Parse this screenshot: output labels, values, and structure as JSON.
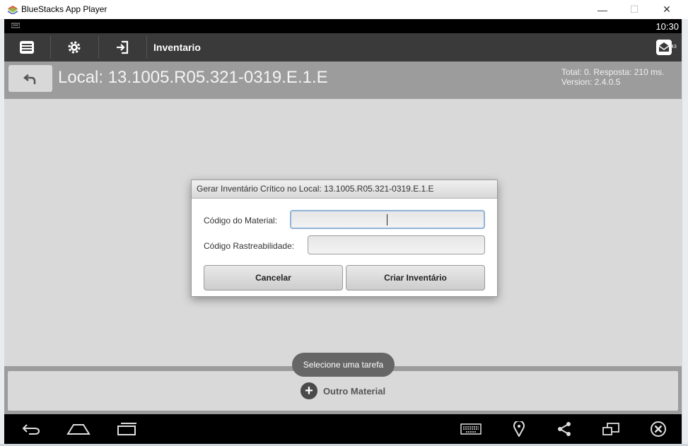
{
  "window": {
    "title": "BlueStacks App Player",
    "minimize": "—",
    "maximize": "☐",
    "close": "✕"
  },
  "status_bar": {
    "time": "10:30"
  },
  "action_bar": {
    "title": "Inventario",
    "icons": [
      "menu-icon",
      "gear-icon",
      "login-icon",
      "mail-icon"
    ],
    "mail_count": "43"
  },
  "header": {
    "local": "Local: 13.1005.R05.321-0319.E.1.E",
    "total": "Total: 0. Resposta: 210 ms.",
    "version": "Version: 2.4.0.5"
  },
  "dialog": {
    "title": "Gerar Inventário Crítico no Local: 13.1005.R05.321-0319.E.1.E",
    "material_label": "Código do Material:",
    "material_value": "",
    "rastre_label": "Código Rastreabilidade:",
    "rastre_value": "",
    "cancel_label": "Cancelar",
    "create_label": "Criar Inventário"
  },
  "toast": "Selecione uma tarefa",
  "bottom": {
    "outro_label": "Outro Material"
  },
  "nav_bar": {
    "icons": [
      "back-icon",
      "home-icon",
      "recent-apps-icon",
      "keyboard-icon",
      "location-icon",
      "share-icon",
      "screen-icon",
      "close-icon"
    ]
  },
  "colors": {
    "action_bar": "#3a3a3a",
    "header": "#9c9c9c",
    "background": "#d9d9d9"
  }
}
